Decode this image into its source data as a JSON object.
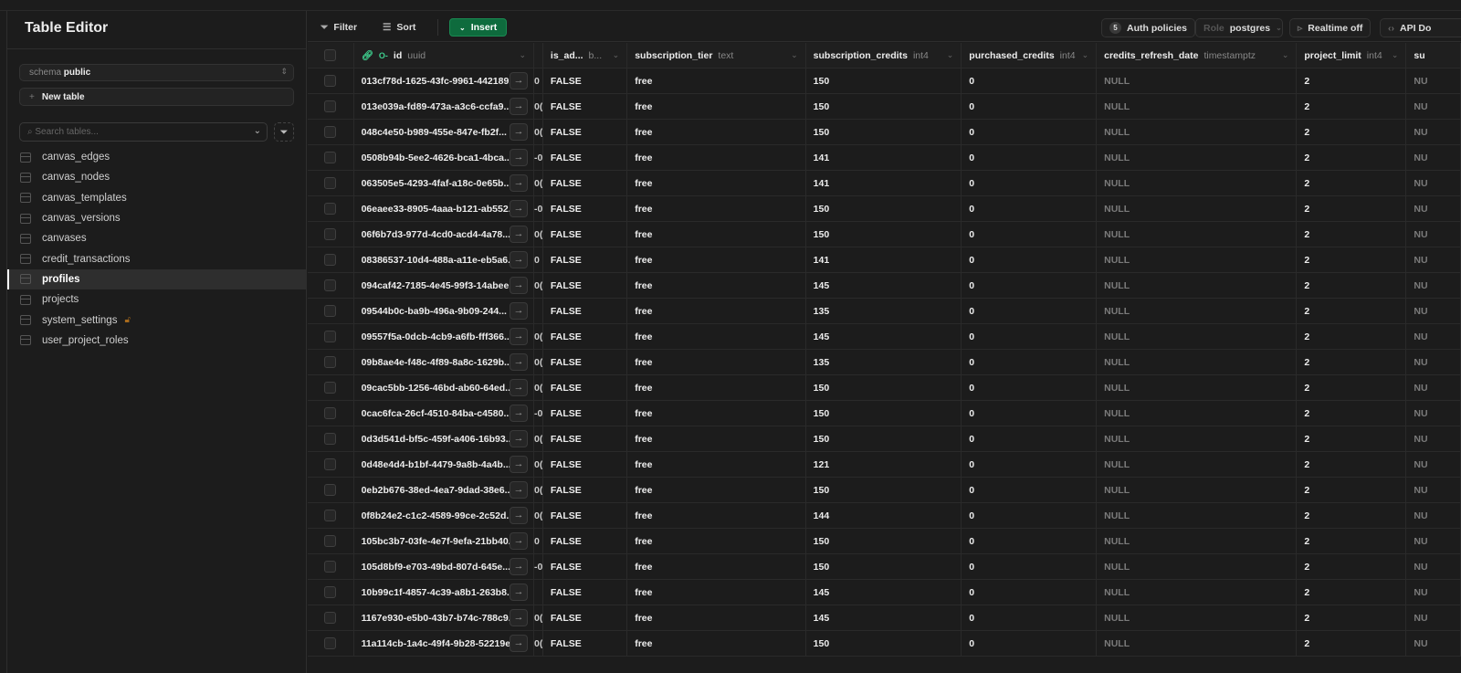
{
  "sidebar": {
    "title": "Table Editor",
    "schema_label": "schema",
    "schema_value": "public",
    "new_table": "New table",
    "search_placeholder": "Search tables...",
    "tables": [
      {
        "name": "canvas_edges"
      },
      {
        "name": "canvas_nodes"
      },
      {
        "name": "canvas_templates"
      },
      {
        "name": "canvas_versions"
      },
      {
        "name": "canvases"
      },
      {
        "name": "credit_transactions"
      },
      {
        "name": "profiles",
        "active": true
      },
      {
        "name": "projects"
      },
      {
        "name": "system_settings",
        "locked": true
      },
      {
        "name": "user_project_roles"
      }
    ]
  },
  "toolbar": {
    "filter": "Filter",
    "sort": "Sort",
    "insert": "Insert",
    "auth_count": "5",
    "auth_policies": "Auth policies",
    "role_label": "Role",
    "role_value": "postgres",
    "realtime": "Realtime off",
    "api_docs": "API Do"
  },
  "columns": [
    {
      "name": "id",
      "type": "uuid"
    },
    {
      "name": "",
      "type": ""
    },
    {
      "name": "is_ad...",
      "type": "b..."
    },
    {
      "name": "subscription_tier",
      "type": "text"
    },
    {
      "name": "subscription_credits",
      "type": "int4"
    },
    {
      "name": "purchased_credits",
      "type": "int4"
    },
    {
      "name": "credits_refresh_date",
      "type": "timestamptz"
    },
    {
      "name": "project_limit",
      "type": "int4"
    },
    {
      "name": "su",
      "type": ""
    }
  ],
  "colors": {
    "accent": "#3ecf8e",
    "insert": "#0e6b3d",
    "lock": "#a86a1c"
  },
  "rows": [
    [
      "013cf78d-1625-43fc-9961-442189...",
      "0",
      "FALSE",
      "free",
      "150",
      "0",
      "NULL",
      "2",
      "NU"
    ],
    [
      "013e039a-fd89-473a-a3c6-ccfa9...",
      "0(",
      "FALSE",
      "free",
      "150",
      "0",
      "NULL",
      "2",
      "NU"
    ],
    [
      "048c4e50-b989-455e-847e-fb2f...",
      "0(",
      "FALSE",
      "free",
      "150",
      "0",
      "NULL",
      "2",
      "NU"
    ],
    [
      "0508b94b-5ee2-4626-bca1-4bca...",
      "-0",
      "FALSE",
      "free",
      "141",
      "0",
      "NULL",
      "2",
      "NU"
    ],
    [
      "063505e5-4293-4faf-a18c-0e65b...",
      "0(",
      "FALSE",
      "free",
      "141",
      "0",
      "NULL",
      "2",
      "NU"
    ],
    [
      "06eaee33-8905-4aaa-b121-ab552...",
      "-0",
      "FALSE",
      "free",
      "150",
      "0",
      "NULL",
      "2",
      "NU"
    ],
    [
      "06f6b7d3-977d-4cd0-acd4-4a78...",
      "0(",
      "FALSE",
      "free",
      "150",
      "0",
      "NULL",
      "2",
      "NU"
    ],
    [
      "08386537-10d4-488a-a11e-eb5a6...",
      "0",
      "FALSE",
      "free",
      "141",
      "0",
      "NULL",
      "2",
      "NU"
    ],
    [
      "094caf42-7185-4e45-99f3-14abee...",
      "0(",
      "FALSE",
      "free",
      "145",
      "0",
      "NULL",
      "2",
      "NU"
    ],
    [
      "09544b0c-ba9b-496a-9b09-244...",
      "",
      "FALSE",
      "free",
      "135",
      "0",
      "NULL",
      "2",
      "NU"
    ],
    [
      "09557f5a-0dcb-4cb9-a6fb-fff366...",
      "0(",
      "FALSE",
      "free",
      "145",
      "0",
      "NULL",
      "2",
      "NU"
    ],
    [
      "09b8ae4e-f48c-4f89-8a8c-1629b...",
      "0(",
      "FALSE",
      "free",
      "135",
      "0",
      "NULL",
      "2",
      "NU"
    ],
    [
      "09cac5bb-1256-46bd-ab60-64ed...",
      "0(",
      "FALSE",
      "free",
      "150",
      "0",
      "NULL",
      "2",
      "NU"
    ],
    [
      "0cac6fca-26cf-4510-84ba-c4580...",
      "-0",
      "FALSE",
      "free",
      "150",
      "0",
      "NULL",
      "2",
      "NU"
    ],
    [
      "0d3d541d-bf5c-459f-a406-16b93...",
      "0(",
      "FALSE",
      "free",
      "150",
      "0",
      "NULL",
      "2",
      "NU"
    ],
    [
      "0d48e4d4-b1bf-4479-9a8b-4a4b...",
      "0(",
      "FALSE",
      "free",
      "121",
      "0",
      "NULL",
      "2",
      "NU"
    ],
    [
      "0eb2b676-38ed-4ea7-9dad-38e6...",
      "0(",
      "FALSE",
      "free",
      "150",
      "0",
      "NULL",
      "2",
      "NU"
    ],
    [
      "0f8b24e2-c1c2-4589-99ce-2c52d...",
      "0(",
      "FALSE",
      "free",
      "144",
      "0",
      "NULL",
      "2",
      "NU"
    ],
    [
      "105bc3b7-03fe-4e7f-9efa-21bb40...",
      "0",
      "FALSE",
      "free",
      "150",
      "0",
      "NULL",
      "2",
      "NU"
    ],
    [
      "105d8bf9-e703-49bd-807d-645e...",
      "-0",
      "FALSE",
      "free",
      "150",
      "0",
      "NULL",
      "2",
      "NU"
    ],
    [
      "10b99c1f-4857-4c39-a8b1-263b8...",
      "",
      "FALSE",
      "free",
      "145",
      "0",
      "NULL",
      "2",
      "NU"
    ],
    [
      "1167e930-e5b0-43b7-b74c-788c9...",
      "0(",
      "FALSE",
      "free",
      "145",
      "0",
      "NULL",
      "2",
      "NU"
    ],
    [
      "11a114cb-1a4c-49f4-9b28-52219ec...",
      "0(",
      "FALSE",
      "free",
      "150",
      "0",
      "NULL",
      "2",
      "NU"
    ]
  ]
}
